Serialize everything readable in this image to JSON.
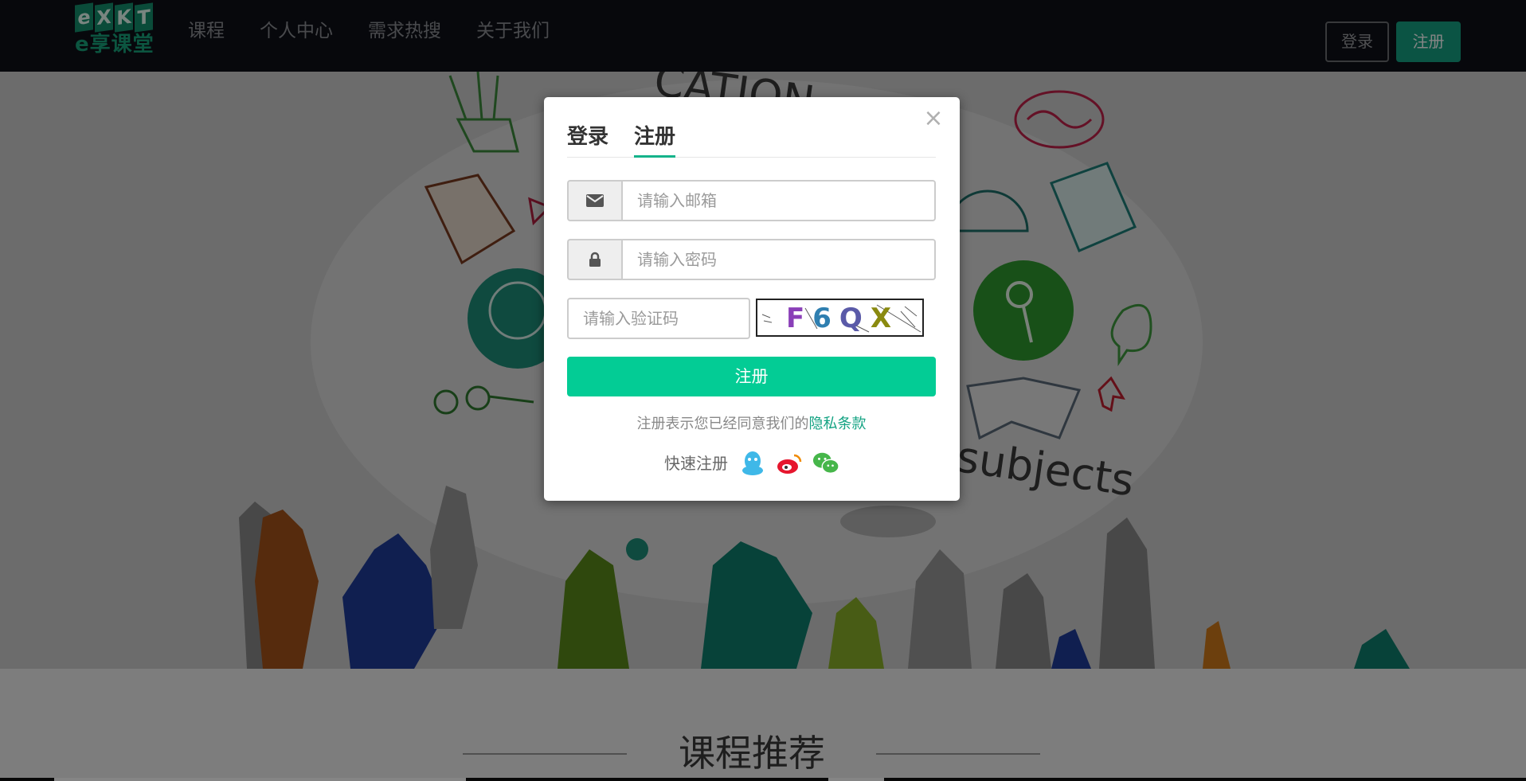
{
  "navbar": {
    "logo_letters": [
      "e",
      "X",
      "K",
      "T"
    ],
    "logo_text": "e享课堂",
    "items": [
      "课程",
      "个人中心",
      "需求热搜",
      "关于我们"
    ],
    "login_label": "登录",
    "register_label": "注册"
  },
  "hero": {
    "background_words": [
      "CATION",
      "subjects"
    ],
    "carousel_dots": 4,
    "active_dot": 4
  },
  "section": {
    "title": "课程推荐"
  },
  "modal": {
    "close_symbol": "×",
    "tabs": [
      {
        "label": "登录",
        "active": false
      },
      {
        "label": "注册",
        "active": true
      }
    ],
    "email": {
      "placeholder": "请输入邮箱",
      "icon": "envelope-icon"
    },
    "password": {
      "placeholder": "请输入密码",
      "icon": "lock-icon"
    },
    "captcha": {
      "placeholder": "请输入验证码",
      "code": "F6QX"
    },
    "submit_label": "注册",
    "agreement_text": "注册表示您已经同意我们的",
    "agreement_link": "隐私条款",
    "quick_register_label": "快速注册",
    "social_icons": [
      "qq-icon",
      "weibo-icon",
      "wechat-icon"
    ]
  },
  "colors": {
    "navbar_bg": "#0f1018",
    "accent": "#03cc95",
    "accent_dark": "#16a283",
    "link": "#14a383",
    "active_dot": "#b3000a"
  }
}
